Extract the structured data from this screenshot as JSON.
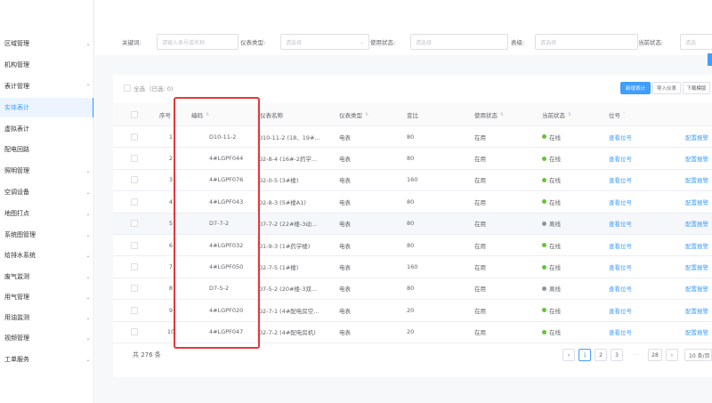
{
  "sidebar": {
    "items": [
      {
        "label": "区域管理",
        "arrow": "⌄",
        "active": false
      },
      {
        "label": "机构管理",
        "arrow": "",
        "active": false
      },
      {
        "label": "表计管理",
        "arrow": "⌃",
        "active": false
      },
      {
        "label": "实体表计",
        "arrow": "",
        "active": true
      },
      {
        "label": "虚拟表计",
        "arrow": "",
        "active": false
      },
      {
        "label": "配电回路",
        "arrow": "",
        "active": false
      },
      {
        "label": "照明管理",
        "arrow": "⌄",
        "active": false
      },
      {
        "label": "空调设备",
        "arrow": "⌄",
        "active": false
      },
      {
        "label": "地图打点",
        "arrow": "⌄",
        "active": false
      },
      {
        "label": "系统图管理",
        "arrow": "⌄",
        "active": false
      },
      {
        "label": "给排水系统",
        "arrow": "⌄",
        "active": false
      },
      {
        "label": "废气监测",
        "arrow": "⌄",
        "active": false
      },
      {
        "label": "用气管理",
        "arrow": "⌄",
        "active": false
      },
      {
        "label": "用油监测",
        "arrow": "⌄",
        "active": false
      },
      {
        "label": "视频管理",
        "arrow": "⌄",
        "active": false
      },
      {
        "label": "工单服务",
        "arrow": "⌄",
        "active": false
      }
    ]
  },
  "filters": [
    {
      "label": "关键词:",
      "placeholder": "请输入表号或名称",
      "chevron": ""
    },
    {
      "label": "仪表类型:",
      "placeholder": "请选择",
      "chevron": "⌄"
    },
    {
      "label": "使用状态:",
      "placeholder": "请选择",
      "chevron": ""
    },
    {
      "label": "表级:",
      "placeholder": "请选择",
      "chevron": ""
    },
    {
      "label": "当前状态:",
      "placeholder": "请选",
      "chevron": ""
    }
  ],
  "toolbar": {
    "select_all": "全选",
    "selected": "(已选: 0)",
    "add_button": "新增表计",
    "import_button": "导入仪表",
    "download_button": "下载模版"
  },
  "table": {
    "headers": {
      "index": "序号",
      "code": "编码",
      "name": "仪表名称",
      "type": "仪表类型",
      "ratio": "变比",
      "use_status": "使用状态",
      "cur_status": "当前状态",
      "position": "位号"
    },
    "rows": [
      {
        "index": "1",
        "code": "D10-11-2",
        "name": "D10-11-2 (18、19#...",
        "type": "电表",
        "ratio": "80",
        "use_status": "在用",
        "cur_status": "在线",
        "online": true,
        "position": "查看位号",
        "action": "配置报警"
      },
      {
        "index": "2",
        "code": "4#LGPF044",
        "name": "D2-8-4 (16#-2药学...",
        "type": "电表",
        "ratio": "80",
        "use_status": "在用",
        "cur_status": "在线",
        "online": true,
        "position": "查看位号",
        "action": "配置报警"
      },
      {
        "index": "3",
        "code": "4#LGPF076",
        "name": "D2-0-5 (3#楼)",
        "type": "电表",
        "ratio": "160",
        "use_status": "在用",
        "cur_status": "在线",
        "online": true,
        "position": "查看位号",
        "action": "配置报警"
      },
      {
        "index": "4",
        "code": "4#LGPF043",
        "name": "D2-8-3 (5#楼A1)",
        "type": "电表",
        "ratio": "80",
        "use_status": "在用",
        "cur_status": "在线",
        "online": true,
        "position": "查看位号",
        "action": "配置报警"
      },
      {
        "index": "5",
        "code": "D7-7-2",
        "name": "D7-7-2 (22#楼-3动...",
        "type": "电表",
        "ratio": "80",
        "use_status": "在用",
        "cur_status": "离线",
        "online": false,
        "position": "查看位号",
        "action": "配置报警"
      },
      {
        "index": "6",
        "code": "4#LGPF032",
        "name": "D1-9-3 (1#药学楼)",
        "type": "电表",
        "ratio": "80",
        "use_status": "在用",
        "cur_status": "在线",
        "online": true,
        "position": "查看位号",
        "action": "配置报警"
      },
      {
        "index": "7",
        "code": "4#LGPF050",
        "name": "D2-7-5 (1#楼)",
        "type": "电表",
        "ratio": "160",
        "use_status": "在用",
        "cur_status": "在线",
        "online": true,
        "position": "查看位号",
        "action": "配置报警"
      },
      {
        "index": "8",
        "code": "D7-5-2",
        "name": "D7-5-2 (20#楼-3双...",
        "type": "电表",
        "ratio": "80",
        "use_status": "在用",
        "cur_status": "离线",
        "online": false,
        "position": "查看位号",
        "action": "配置报警"
      },
      {
        "index": "9",
        "code": "4#LGPF020",
        "name": "D2-7-1 (4#配电房空...",
        "type": "电表",
        "ratio": "20",
        "use_status": "在用",
        "cur_status": "在线",
        "online": true,
        "position": "查看位号",
        "action": "配置报警"
      },
      {
        "index": "10",
        "code": "4#LGPF047",
        "name": "D2-7-2 (4#配电房机)",
        "type": "电表",
        "ratio": "20",
        "use_status": "在用",
        "cur_status": "在线",
        "online": true,
        "position": "查看位号",
        "action": "配置报警"
      }
    ]
  },
  "pagination": {
    "total": "共 276 条",
    "prev": "‹",
    "pages": [
      "1",
      "2",
      "3"
    ],
    "ellipsis": "···",
    "last": "28",
    "next": "›",
    "page_size": "10 条/页"
  },
  "colors": {
    "accent": "#409eff",
    "online": "#67c23a",
    "offline": "#909399",
    "highlight": "#e5383b"
  }
}
